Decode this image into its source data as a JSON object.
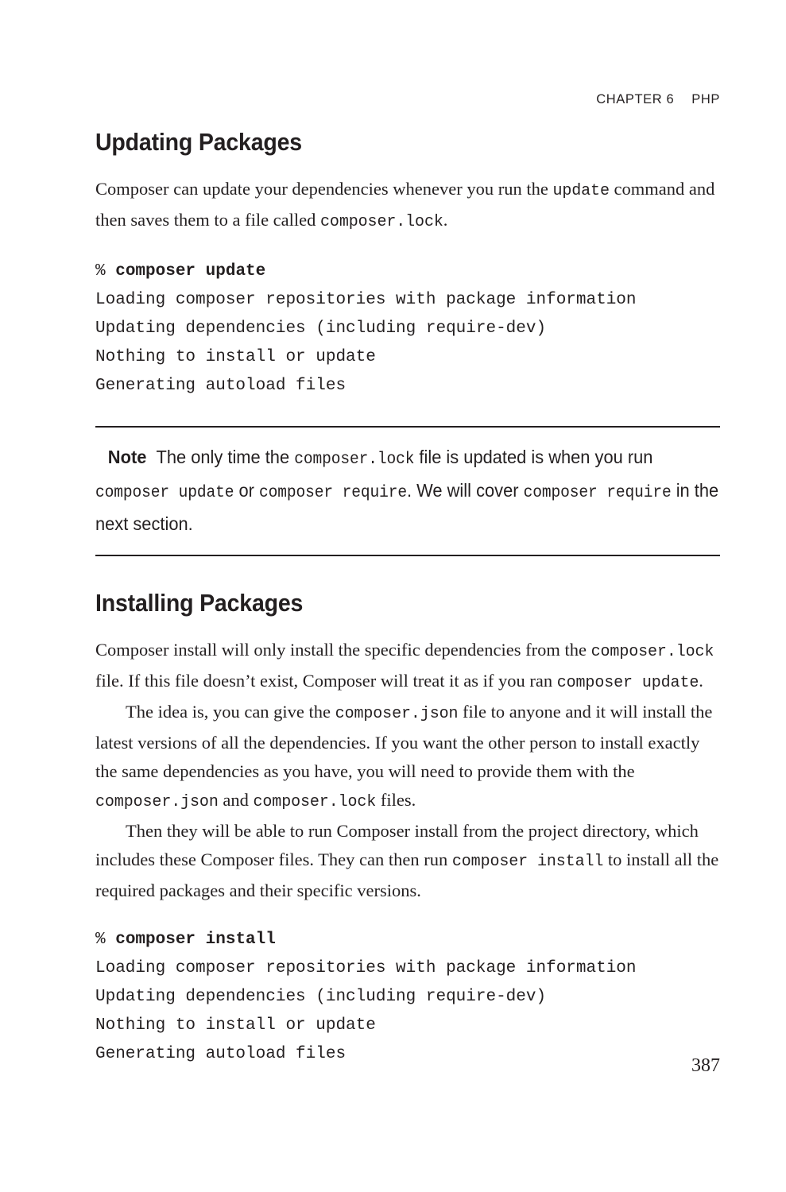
{
  "running_head": {
    "chapter": "CHAPTER 6",
    "topic": "PHP"
  },
  "sections": [
    {
      "heading": "Updating Packages",
      "paragraph_1": {
        "part_1": "Composer can update your dependencies whenever you run the ",
        "code_1": "update",
        "part_2": " command and then saves them to a file called ",
        "code_2": "composer.lock",
        "part_3": "."
      },
      "code_block": {
        "prompt": "%",
        "command": "composer update",
        "output": [
          "Loading composer repositories with package information",
          "Updating dependencies (including require-dev)",
          "Nothing to install or update",
          "Generating autoload files"
        ]
      }
    },
    {
      "heading": "Installing Packages",
      "paragraph_1": {
        "part_1": "Composer install will only install the specific dependencies from the ",
        "code_1": "composer.lock",
        "part_2": " file. If this file doesn’t exist, Composer will treat it as if you ran ",
        "code_2": "composer update",
        "part_3": "."
      },
      "paragraph_2": {
        "part_1": "The idea is, you can give the ",
        "code_1": "composer.json",
        "part_2": " file to anyone and it will install the latest versions of all the dependencies. If you want the other person to install exactly the same dependencies as you have, you will need to provide them with the ",
        "code_2": "composer.json",
        "part_3": " and ",
        "code_3": "composer.lock",
        "part_4": " files."
      },
      "paragraph_3": {
        "part_1": "Then they will be able to run Composer install from the project directory, which includes these Composer files. They can then run ",
        "code_1": "composer install",
        "part_2": " to install all the required packages and their specific versions."
      },
      "code_block": {
        "prompt": "%",
        "command": "composer install",
        "output": [
          "Loading composer repositories with package information",
          "Updating dependencies (including require-dev)",
          "Nothing to install or update",
          "Generating autoload files"
        ]
      }
    }
  ],
  "note": {
    "label": "Note",
    "part_1": "The only time the ",
    "code_1": "composer.lock",
    "part_2": " file is updated is when you run ",
    "code_2": "composer update",
    "part_3": " or ",
    "code_3": "composer require",
    "part_4": ". We will cover ",
    "code_4": "composer require",
    "part_5": " in the next section."
  },
  "folio": "387"
}
